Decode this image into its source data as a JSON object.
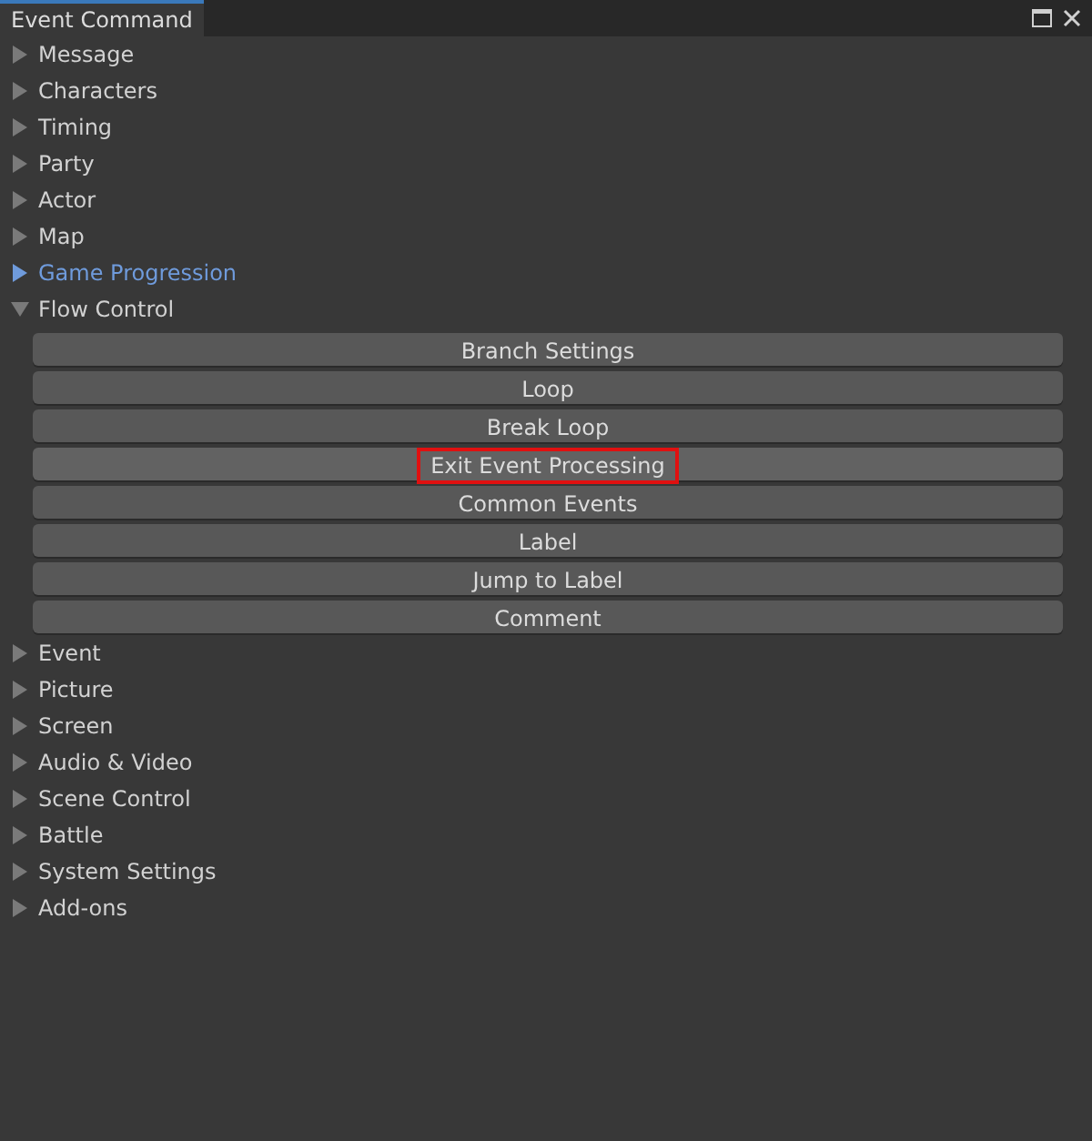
{
  "window": {
    "title": "Event Command"
  },
  "categories": [
    {
      "label": "Message",
      "expanded": false,
      "selected": false
    },
    {
      "label": "Characters",
      "expanded": false,
      "selected": false
    },
    {
      "label": "Timing",
      "expanded": false,
      "selected": false
    },
    {
      "label": "Party",
      "expanded": false,
      "selected": false
    },
    {
      "label": "Actor",
      "expanded": false,
      "selected": false
    },
    {
      "label": "Map",
      "expanded": false,
      "selected": false
    },
    {
      "label": "Game Progression",
      "expanded": false,
      "selected": true
    },
    {
      "label": "Flow Control",
      "expanded": true,
      "selected": false,
      "commands": [
        {
          "label": "Branch Settings",
          "highlighted": false
        },
        {
          "label": "Loop",
          "highlighted": false
        },
        {
          "label": "Break Loop",
          "highlighted": false
        },
        {
          "label": "Exit Event Processing",
          "highlighted": true
        },
        {
          "label": "Common Events",
          "highlighted": false
        },
        {
          "label": "Label",
          "highlighted": false
        },
        {
          "label": "Jump to Label",
          "highlighted": false
        },
        {
          "label": "Comment",
          "highlighted": false
        }
      ]
    },
    {
      "label": "Event",
      "expanded": false,
      "selected": false
    },
    {
      "label": "Picture",
      "expanded": false,
      "selected": false
    },
    {
      "label": "Screen",
      "expanded": false,
      "selected": false
    },
    {
      "label": "Audio & Video",
      "expanded": false,
      "selected": false
    },
    {
      "label": "Scene Control",
      "expanded": false,
      "selected": false
    },
    {
      "label": "Battle",
      "expanded": false,
      "selected": false
    },
    {
      "label": "System Settings",
      "expanded": false,
      "selected": false
    },
    {
      "label": "Add-ons",
      "expanded": false,
      "selected": false
    }
  ]
}
